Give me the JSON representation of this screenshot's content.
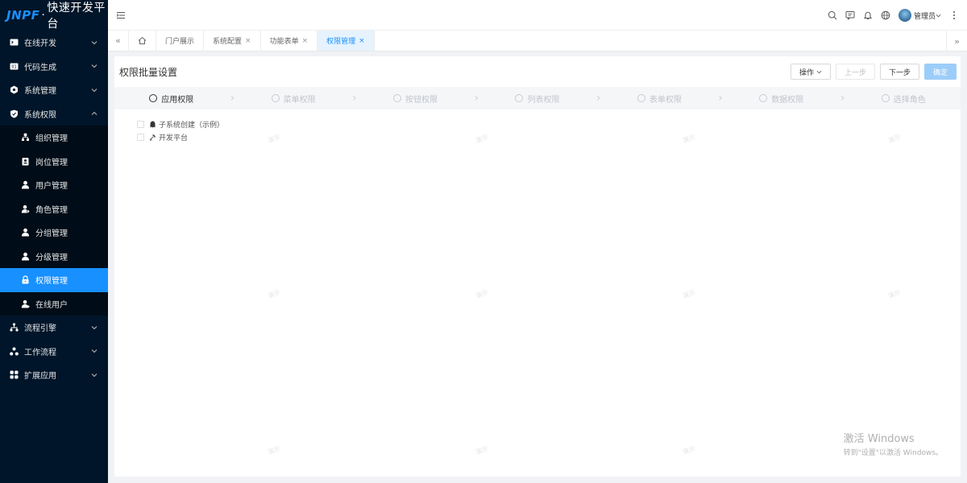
{
  "logo": {
    "brand": "JNPF",
    "dot": "·",
    "title": "快速开发平台"
  },
  "sidebar": {
    "groups_top": [
      {
        "label": "在线开发",
        "icon": "terminal-icon"
      },
      {
        "label": "代码生成",
        "icon": "code-icon"
      },
      {
        "label": "系统管理",
        "icon": "gear-icon"
      }
    ],
    "open_group": {
      "label": "系统权限",
      "icon": "shield-icon"
    },
    "sub_items": [
      {
        "label": "组织管理",
        "icon": "org-icon"
      },
      {
        "label": "岗位管理",
        "icon": "badge-icon"
      },
      {
        "label": "用户管理",
        "icon": "user-icon"
      },
      {
        "label": "角色管理",
        "icon": "role-icon"
      },
      {
        "label": "分组管理",
        "icon": "group-icon"
      },
      {
        "label": "分级管理",
        "icon": "level-icon"
      },
      {
        "label": "权限管理",
        "icon": "lock-icon",
        "active": true
      },
      {
        "label": "在线用户",
        "icon": "online-user-icon"
      }
    ],
    "groups_bottom": [
      {
        "label": "流程引擎",
        "icon": "flow-icon"
      },
      {
        "label": "工作流程",
        "icon": "workflow-icon"
      },
      {
        "label": "扩展应用",
        "icon": "apps-icon"
      }
    ]
  },
  "header": {
    "user_name": "管理员"
  },
  "tabs": [
    {
      "label": "门户展示",
      "closable": false
    },
    {
      "label": "系统配置",
      "closable": true
    },
    {
      "label": "功能表单",
      "closable": true
    },
    {
      "label": "权限管理",
      "closable": true,
      "active": true
    }
  ],
  "tab_close_glyph": "×",
  "panel": {
    "title": "权限批量设置",
    "buttons": {
      "actions": "操作",
      "prev": "上一步",
      "next": "下一步",
      "confirm": "确定"
    },
    "steps": [
      "应用权限",
      "菜单权限",
      "按钮权限",
      "列表权限",
      "表单权限",
      "数据权限",
      "选择角色"
    ],
    "current_step": 0,
    "tree": [
      {
        "label": "子系统创建（示例）",
        "icon": "app-icon"
      },
      {
        "label": "开发平台",
        "icon": "tool-icon"
      }
    ],
    "watermark": "演示"
  },
  "windows_activation": {
    "line1": "激活 Windows",
    "line2": "转到\"设置\"以激活 Windows。"
  },
  "colors": {
    "sidebar_bg": "#001529",
    "accent": "#1890ff"
  }
}
